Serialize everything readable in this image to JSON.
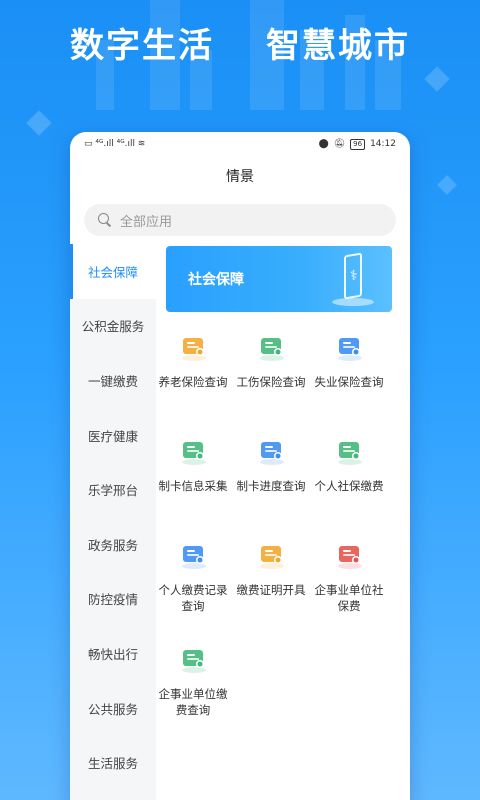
{
  "banner": {
    "left_text": "数字生活",
    "right_text": "智慧城市"
  },
  "status_bar": {
    "left_icons": "▭ ⁴ᴳ.ıll ⁴ᴳ.ıll ≋",
    "battery": "96",
    "time": "14:12"
  },
  "page": {
    "title": "情景"
  },
  "search": {
    "placeholder": "全部应用"
  },
  "sidebar": {
    "items": [
      {
        "label": "社会保障",
        "active": true
      },
      {
        "label": "公积金服务"
      },
      {
        "label": "一键缴费"
      },
      {
        "label": "医疗健康"
      },
      {
        "label": "乐学邢台"
      },
      {
        "label": "政务服务"
      },
      {
        "label": "防控疫情"
      },
      {
        "label": "畅快出行"
      },
      {
        "label": "公共服务"
      },
      {
        "label": "生活服务"
      }
    ]
  },
  "hero": {
    "title": "社会保障"
  },
  "services": [
    {
      "label": "养老保险查询",
      "icon": "pension-icon",
      "color": "#f3a72f"
    },
    {
      "label": "工伤保险查询",
      "icon": "injury-icon",
      "color": "#43b87a"
    },
    {
      "label": "失业保险查询",
      "icon": "unemployment-icon",
      "color": "#3d8ff5"
    },
    {
      "label": "制卡信息采集",
      "icon": "card-info-icon",
      "color": "#43b87a"
    },
    {
      "label": "制卡进度查询",
      "icon": "card-progress-icon",
      "color": "#3d8ff5"
    },
    {
      "label": "个人社保缴费",
      "icon": "personal-payment-icon",
      "color": "#43b87a"
    },
    {
      "label": "个人缴费记录查询",
      "icon": "payment-record-icon",
      "color": "#3d8ff5"
    },
    {
      "label": "缴费证明开具",
      "icon": "payment-certificate-icon",
      "color": "#f3a72f"
    },
    {
      "label": "企事业单位社保费",
      "icon": "enterprise-fee-icon",
      "color": "#e5554f"
    },
    {
      "label": "企事业单位缴费查询",
      "icon": "enterprise-query-icon",
      "color": "#43b87a"
    }
  ]
}
